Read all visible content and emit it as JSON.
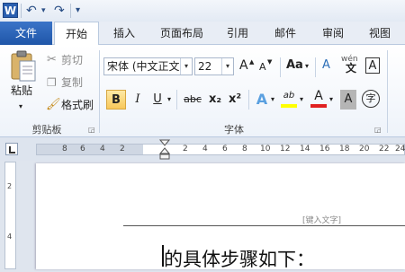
{
  "qat": {
    "logo": "W",
    "undo": "↶",
    "redo": "↷",
    "customize": "▾"
  },
  "tabs": [
    "文件",
    "开始",
    "插入",
    "页面布局",
    "引用",
    "邮件",
    "审阅",
    "视图"
  ],
  "clipboard": {
    "paste": "粘贴",
    "cut": "剪切",
    "copy": "复制",
    "format_painter": "格式刷",
    "group": "剪贴板"
  },
  "font": {
    "name": "宋体 (中文正文",
    "size": "22",
    "grow": "A",
    "shrink": "A",
    "case": "Aa",
    "clear": "A",
    "phonetic": "wén",
    "border_char": "A",
    "bold": "B",
    "italic": "I",
    "underline": "U",
    "strike": "abc",
    "subscript": "x₂",
    "superscript": "x²",
    "effects": "A",
    "highlight": "ab",
    "color": "A",
    "shading": "A",
    "enclose": "字",
    "group": "字体"
  },
  "ruler_numbers": [
    "8",
    "6",
    "4",
    "2",
    "2",
    "4",
    "6",
    "8",
    "10",
    "12",
    "14",
    "16",
    "18",
    "20",
    "22",
    "24",
    "26"
  ],
  "vruler_numbers": [
    "2",
    "4"
  ],
  "document": {
    "header_hint": "[键入文字]",
    "body": "的具体步骤如下："
  },
  "colors": {
    "file_tab": "#2a62b8",
    "highlight": "#ffff00",
    "font_color": "#e02020"
  }
}
